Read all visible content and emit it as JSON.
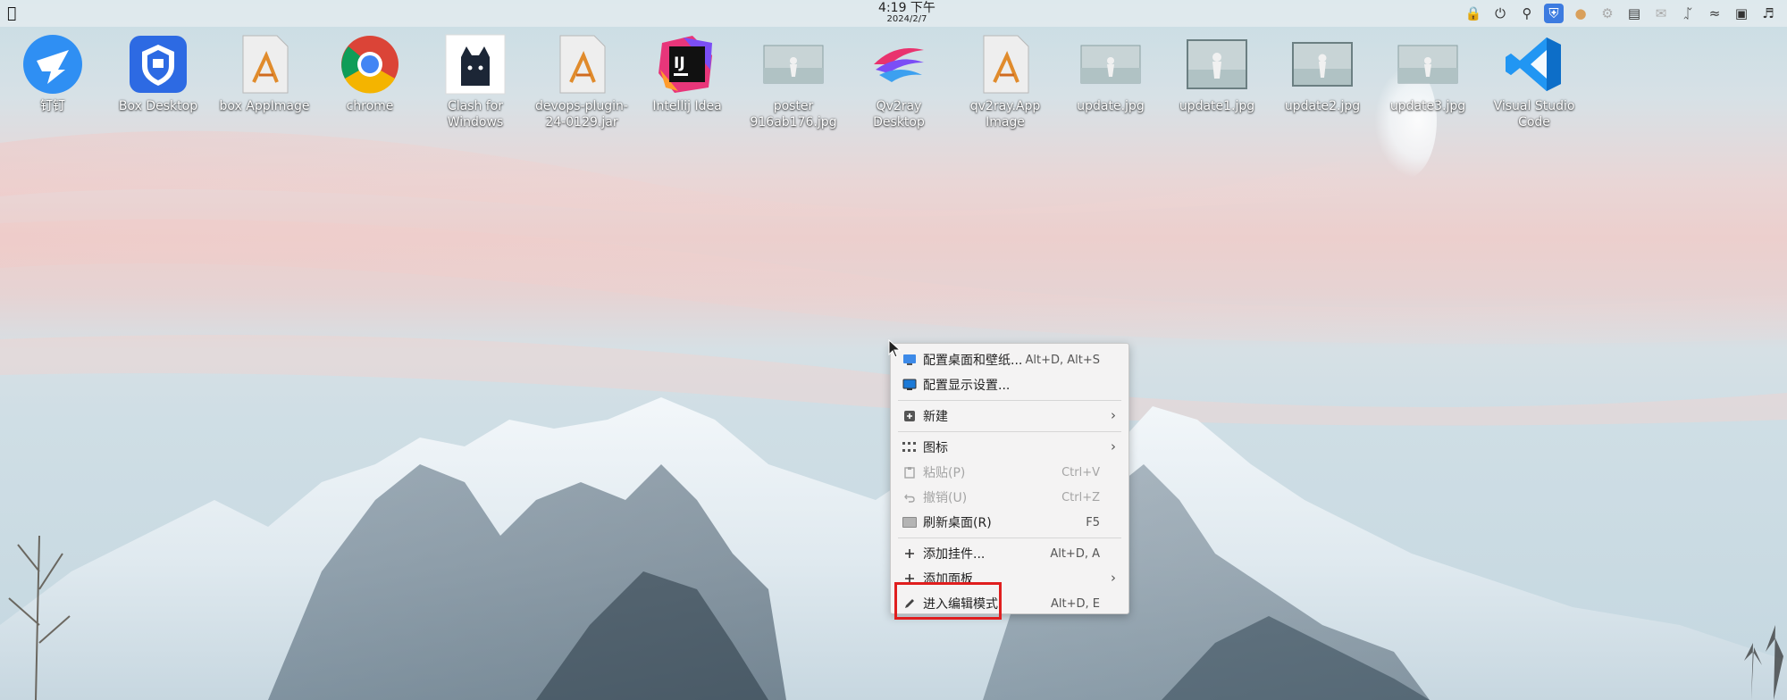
{
  "topbar": {
    "time": "4:19 下午",
    "date": "2024/2/7",
    "tray_icons": [
      "lock-icon",
      "power-icon",
      "search-icon",
      "shield-app-icon",
      "cat-app-icon",
      "gear-badge-icon",
      "clipboard-icon",
      "mail-icon",
      "bluetooth-icon",
      "wifi-icon",
      "display-icon",
      "volume-icon"
    ]
  },
  "desktop": {
    "icons": [
      {
        "label": "钉钉",
        "icon": "dingtalk-icon"
      },
      {
        "label": "Box Desktop",
        "icon": "box-desktop-icon"
      },
      {
        "label": "box AppImage",
        "icon": "appimage-icon"
      },
      {
        "label": "chrome",
        "icon": "chrome-icon"
      },
      {
        "label": "Clash for Windows",
        "icon": "clash-cat-icon"
      },
      {
        "label": "devops-plugin-24-0129.jar",
        "icon": "jar-file-icon"
      },
      {
        "label": "Intellij Idea",
        "icon": "intellij-icon"
      },
      {
        "label": "poster 916ab176.jpg",
        "icon": "image-thumbnail-icon"
      },
      {
        "label": "Qv2ray Desktop",
        "icon": "qv2ray-icon"
      },
      {
        "label": "qv2ray.App Image",
        "icon": "appimage-icon"
      },
      {
        "label": "update.jpg",
        "icon": "image-thumbnail-icon"
      },
      {
        "label": "update1.jpg",
        "icon": "image-thumbnail-icon"
      },
      {
        "label": "update2.jpg",
        "icon": "image-thumbnail-icon"
      },
      {
        "label": "update3.jpg",
        "icon": "image-thumbnail-icon"
      },
      {
        "label": "Visual Studio Code",
        "icon": "vscode-icon"
      }
    ]
  },
  "context_menu": {
    "items": [
      {
        "label": "配置桌面和壁纸...",
        "shortcut": "Alt+D, Alt+S",
        "icon": "desktop-config-icon",
        "disabled": false
      },
      {
        "label": "配置显示设置...",
        "shortcut": "",
        "icon": "display-settings-icon",
        "disabled": false
      },
      {
        "label": "新建",
        "shortcut": "",
        "icon": "new-icon",
        "disabled": false,
        "submenu": true
      },
      {
        "label": "图标",
        "shortcut": "",
        "icon": "grid-icon",
        "disabled": false,
        "submenu": true
      },
      {
        "label": "粘贴(P)",
        "shortcut": "Ctrl+V",
        "icon": "paste-icon",
        "disabled": true
      },
      {
        "label": "撤销(U)",
        "shortcut": "Ctrl+Z",
        "icon": "undo-icon",
        "disabled": true
      },
      {
        "label": "刷新桌面(R)",
        "shortcut": "F5",
        "icon": "refresh-desktop-icon",
        "disabled": false
      },
      {
        "label": "添加挂件...",
        "shortcut": "Alt+D, A",
        "icon": "plus-icon",
        "disabled": false
      },
      {
        "label": "添加面板",
        "shortcut": "",
        "icon": "plus-icon",
        "disabled": false,
        "submenu": true
      },
      {
        "label": "进入编辑模式",
        "shortcut": "Alt+D, E",
        "icon": "pencil-icon",
        "disabled": false
      }
    ]
  },
  "colors": {
    "highlight_box": "#e01e1e",
    "tray_active": "#3c7be0"
  }
}
